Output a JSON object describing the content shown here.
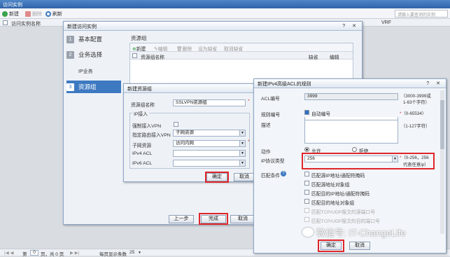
{
  "window": {
    "title": "访问实例"
  },
  "toolbar": {
    "new": "新建",
    "delete": "删除",
    "refresh": "刷新",
    "search_placeholder": "请输入要查询的实例"
  },
  "grid": {
    "col_name": "访问实例名称",
    "col_vrf": "VRF"
  },
  "pager": {
    "page_prefix": "第",
    "page_value": "0",
    "page_suffix": "页，共 0 页",
    "per_page_label": "每页显示条数",
    "per_page_value": "25"
  },
  "wizard": {
    "title": "新建访问实例",
    "steps": [
      {
        "num": "1",
        "label": "基本配置"
      },
      {
        "num": "2",
        "label": "业务选择"
      },
      {
        "num": "",
        "label": "IP业务"
      },
      {
        "num": "3",
        "label": "资源组"
      }
    ],
    "panel_title": "资源组",
    "panel_toolbar": [
      "新建",
      "编辑",
      "删除",
      "设为缺省",
      "取消缺省"
    ],
    "table_cols": [
      "资源组名称",
      "缺省",
      "编辑"
    ],
    "btn_prev": "上一步",
    "btn_finish": "完成",
    "btn_cancel": "取消"
  },
  "resgroup": {
    "title": "新建资源组",
    "name_label": "资源组名称",
    "name_value": "SSLVPN资源组",
    "section": "IP接入",
    "force_vpn_label": "强制接入VPN",
    "route_label": "指定路由接入VPN",
    "route_value": "子网资源",
    "subnet_label": "子网资源",
    "subnet_value": "访问内网",
    "ipv4_label": "IPv4 ACL",
    "ipv6_label": "IPv6 ACL",
    "btn_ok": "确定",
    "btn_cancel": "取消"
  },
  "acl": {
    "title": "新建IPv4高级ACL的规则",
    "acl_no_label": "ACL编号",
    "acl_no_value": "3999",
    "acl_no_hint1": "（3000-3999或",
    "acl_no_hint2": "1-63个字符）",
    "rule_no_label": "规则编号",
    "auto_no_label": "自动编号",
    "rule_no_hint": "（0-65534）",
    "desc_label": "描述",
    "desc_hint": "（1-127字符）",
    "action_label": "动作",
    "permit_label": "允许",
    "deny_label": "拒绝",
    "proto_label": "IP协议类型",
    "proto_value": "256",
    "proto_hint1": "（0-256，256",
    "proto_hint2": "代表任意ip）",
    "match_label": "匹配条件",
    "conditions": [
      "匹配源IP地址/通配符掩码",
      "匹配源地址对象组",
      "匹配目的IP地址/通配符掩码",
      "匹配目的地址对象组",
      "匹配TCP/UDP报文的源端口号",
      "匹配TCP/UDP报文的目的端口号"
    ],
    "btn_ok": "确定",
    "btn_cancel": "取消"
  },
  "watermark": "微信号: IT-ChangeLife"
}
